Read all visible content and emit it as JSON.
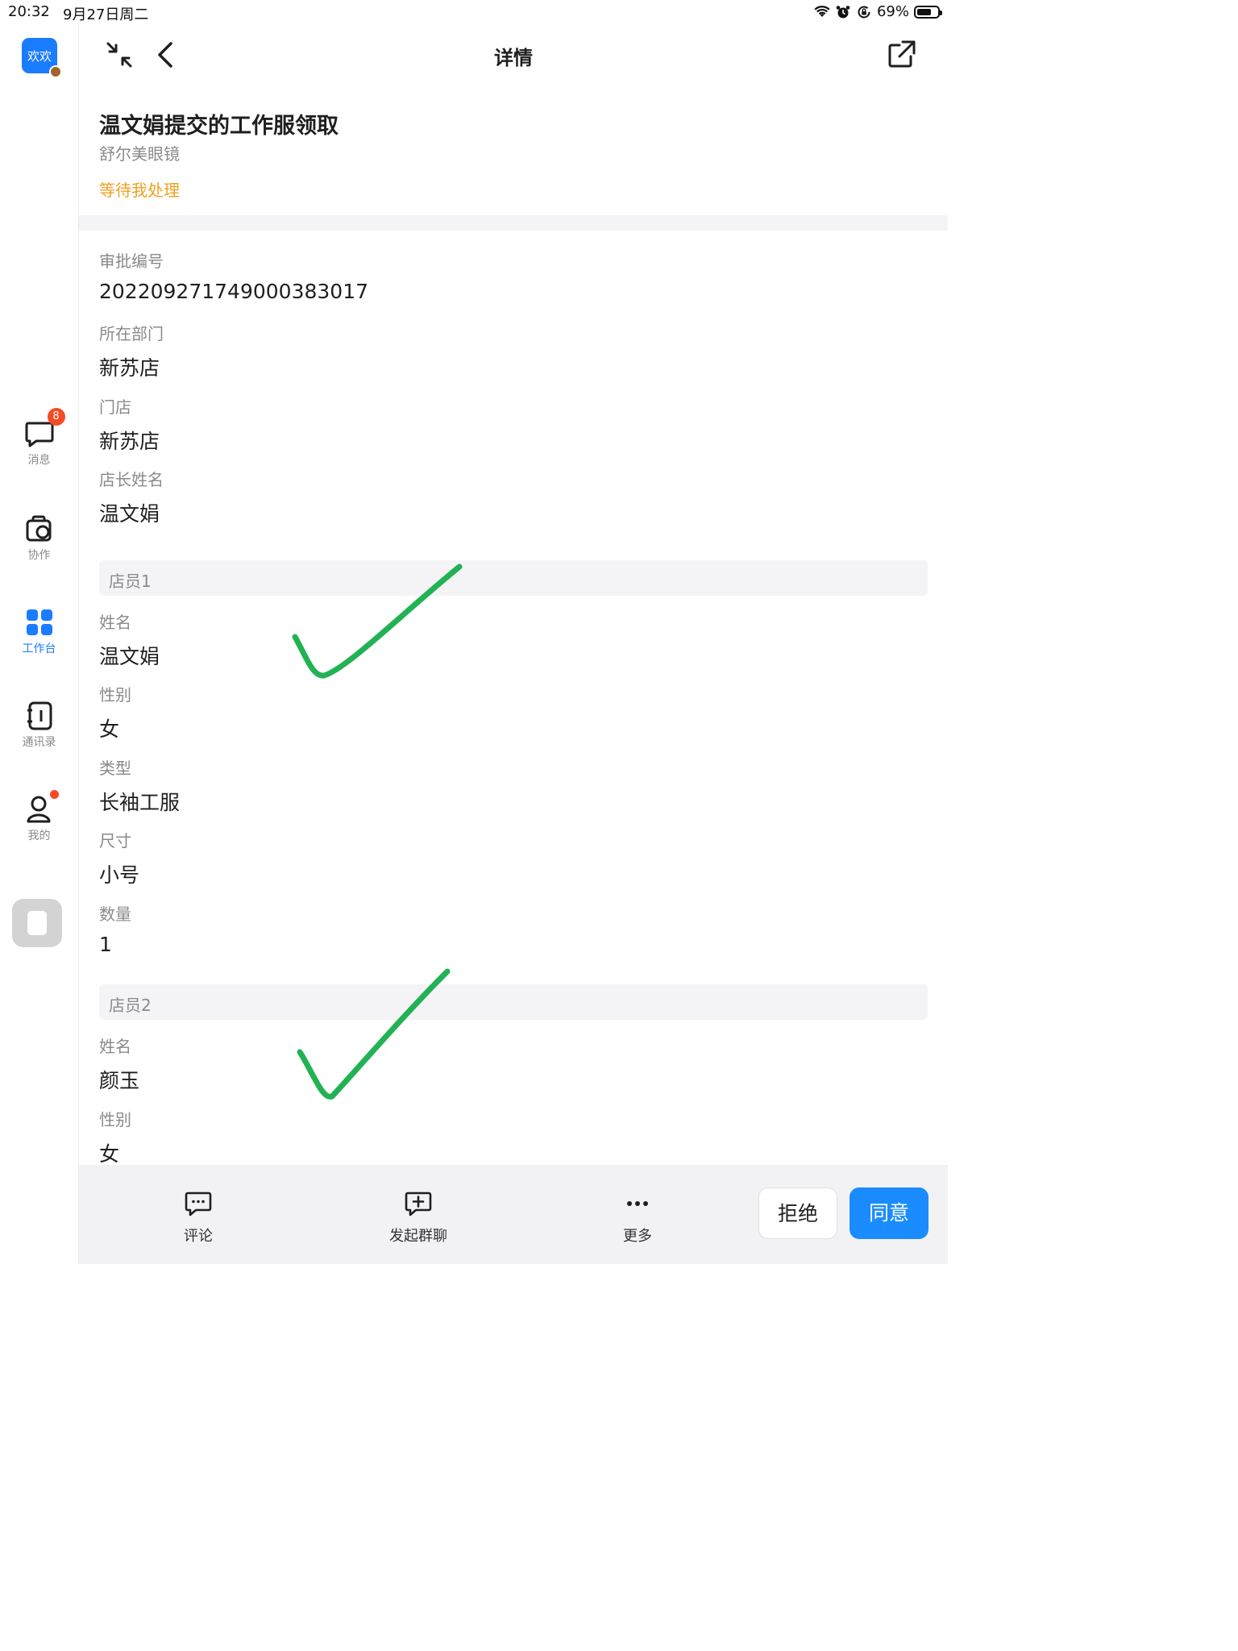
{
  "status_bar": {
    "time": "20:32",
    "date": "9月27日周二",
    "battery_text": "69%",
    "battery_level": 0.69
  },
  "sidebar": {
    "app_label": "欢欢",
    "items": [
      {
        "label": "消息",
        "badge": "8"
      },
      {
        "label": "协作"
      },
      {
        "label": "工作台"
      },
      {
        "label": "通讯录"
      },
      {
        "label": "我的"
      }
    ],
    "active_color": "#1a7cff"
  },
  "header": {
    "title": "详情"
  },
  "summary": {
    "title": "温文娟提交的工作服领取",
    "org": "舒尔美眼镜",
    "status": "等待我处理",
    "status_color": "#f0a020"
  },
  "fields": [
    {
      "label": "审批编号",
      "value": "202209271749000383017"
    },
    {
      "label": "所在部门",
      "value": "新苏店"
    },
    {
      "label": "门店",
      "value": "新苏店"
    },
    {
      "label": "店长姓名",
      "value": "温文娟"
    }
  ],
  "groups": [
    {
      "title": "店员1",
      "fields": [
        {
          "label": "姓名",
          "value": "温文娟"
        },
        {
          "label": "性别",
          "value": "女"
        },
        {
          "label": "类型",
          "value": "长袖工服"
        },
        {
          "label": "尺寸",
          "value": "小号"
        },
        {
          "label": "数量",
          "value": "1"
        }
      ]
    },
    {
      "title": "店员2",
      "fields": [
        {
          "label": "姓名",
          "value": "颜玉"
        },
        {
          "label": "性别",
          "value": "女"
        }
      ]
    }
  ],
  "bottom_bar": {
    "comment_label": "评论",
    "group_chat_label": "发起群聊",
    "more_label": "更多",
    "reject_label": "拒绝",
    "agree_label": "同意"
  }
}
